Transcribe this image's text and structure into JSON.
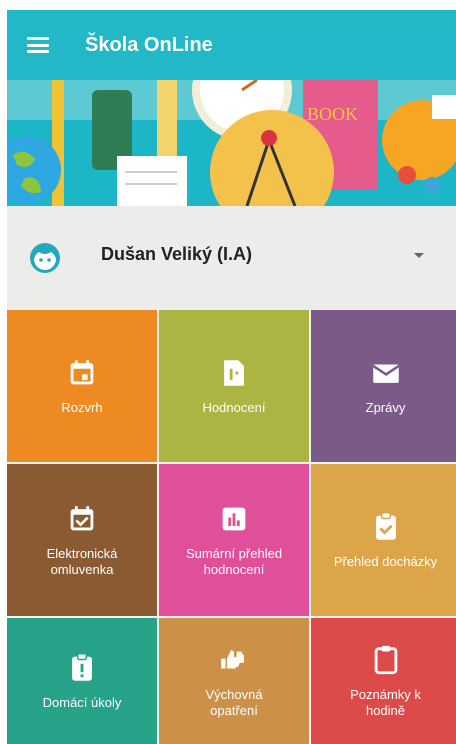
{
  "app": {
    "title": "Škola OnLine"
  },
  "user": {
    "name": "Dušan Veliký (I.A)"
  },
  "tiles": [
    {
      "label": "Rozvrh",
      "color": "#ee8a22",
      "icon": "calendar-icon"
    },
    {
      "label": "Hodnocení",
      "color": "#adb542",
      "icon": "grade-icon"
    },
    {
      "label": "Zprávy",
      "color": "#7b5a88",
      "icon": "mail-icon"
    },
    {
      "label": "Elektronická\nomluvenka",
      "color": "#8a5a32",
      "icon": "calendar-check-icon"
    },
    {
      "label": "Sumární přehled\nhodnocení",
      "color": "#e0509a",
      "icon": "bar-chart-icon"
    },
    {
      "label": "Přehled docházky",
      "color": "#dca548",
      "icon": "clipboard-check-icon"
    },
    {
      "label": "Domácí úkoly",
      "color": "#26a388",
      "icon": "clipboard-alert-icon"
    },
    {
      "label": "Výchovná\nopatření",
      "color": "#cc9048",
      "icon": "thumbs-icon"
    },
    {
      "label": "Poznámky k\nhodině",
      "color": "#dc4a4a",
      "icon": "clipboard-icon"
    }
  ]
}
